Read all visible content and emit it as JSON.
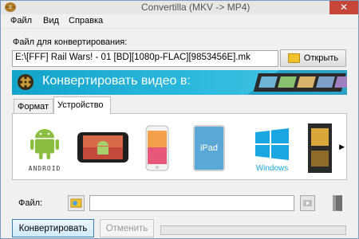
{
  "window": {
    "title": "Convertilla  (MKV -> MP4)",
    "close_glyph": "✕"
  },
  "menu": {
    "items": [
      "Файл",
      "Вид",
      "Справка"
    ]
  },
  "source": {
    "label": "Файл для конвертирования:",
    "path": "E:\\[FFF] Rail Wars! - 01 [BD][1080p-FLAC][9853456E].mk",
    "open_label": "Открыть"
  },
  "banner": {
    "text": "Конвертировать видео в:"
  },
  "tabs": {
    "format": "Формат",
    "device": "Устройство"
  },
  "devices": {
    "android": "ANDROID",
    "ipad": "iPad",
    "windows": "Windows",
    "next_arrow": "▶"
  },
  "output": {
    "label": "Файл:"
  },
  "actions": {
    "convert": "Конвертировать",
    "cancel": "Отменить"
  },
  "progress": {
    "value": 0
  }
}
